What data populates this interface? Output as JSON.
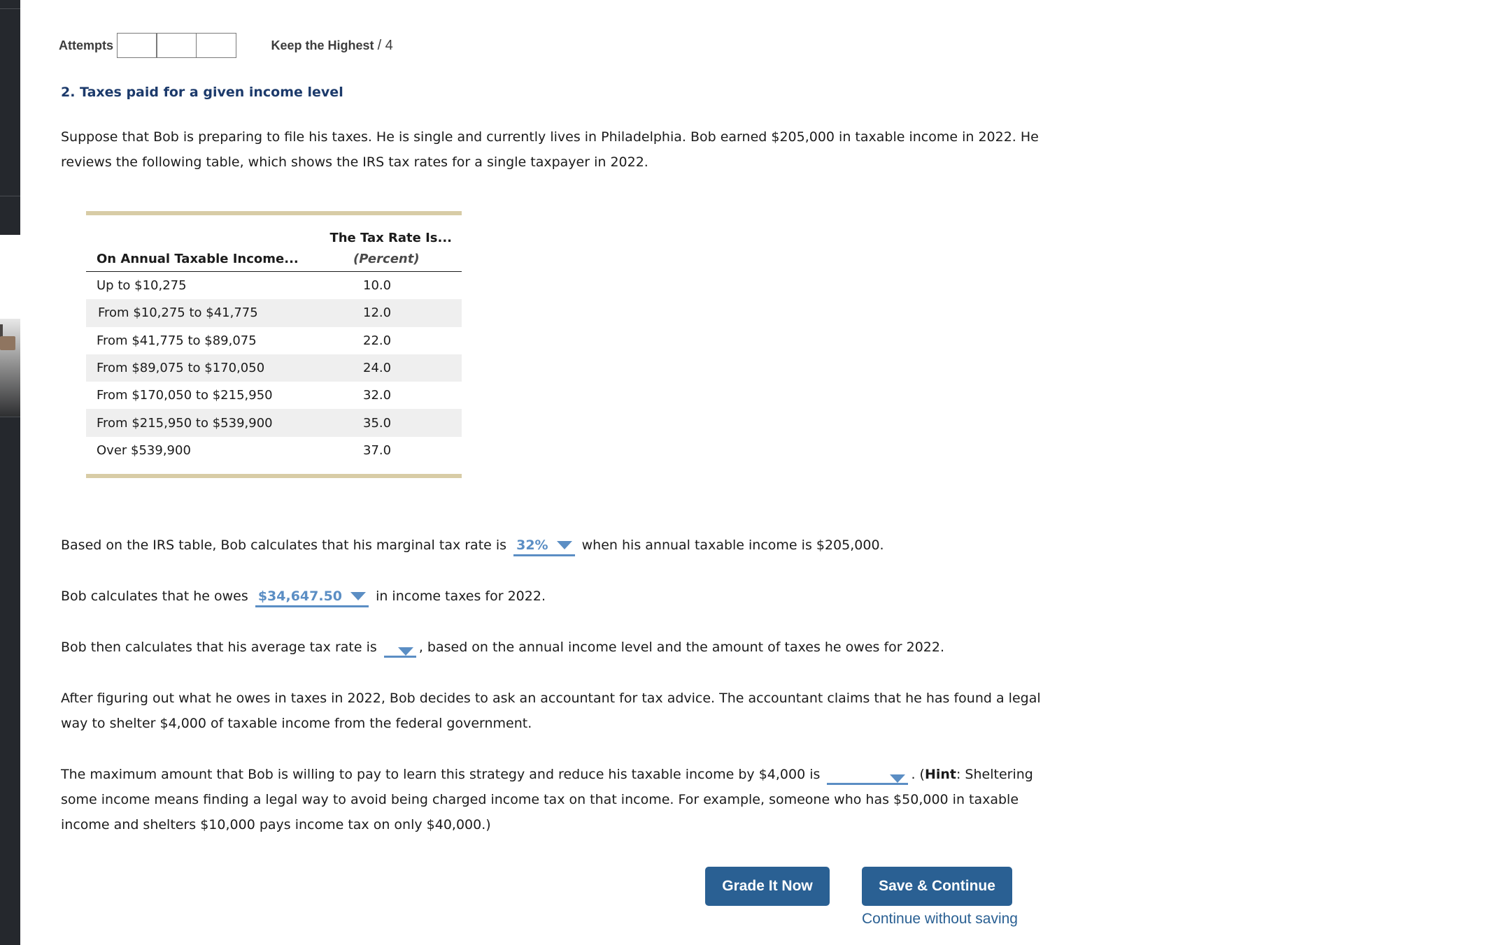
{
  "header": {
    "attempts_label": "Attempts",
    "attempt_boxes": [
      "",
      "",
      ""
    ],
    "keep_label": "Keep the Highest",
    "keep_denominator": "/ 4"
  },
  "question": {
    "title": "2. Taxes paid for a given income level",
    "intro": "Suppose that Bob is preparing to file his taxes. He is single and currently lives in Philadelphia. Bob earned $205,000 in taxable income in 2022. He reviews the following table, which shows the IRS tax rates for a single taxpayer in 2022."
  },
  "tax_table": {
    "col1_header": "On Annual Taxable Income...",
    "col2_header_line1": "The Tax Rate Is...",
    "col2_header_line2": "(Percent)",
    "rows": [
      {
        "income": "Up to $10,275",
        "rate": "10.0"
      },
      {
        "income": "From $10,275 to $41,775",
        "rate": "12.0"
      },
      {
        "income": "From $41,775 to $89,075",
        "rate": "22.0"
      },
      {
        "income": "From $89,075 to $170,050",
        "rate": "24.0"
      },
      {
        "income": "From $170,050 to $215,950",
        "rate": "32.0"
      },
      {
        "income": "From $215,950 to $539,900",
        "rate": "35.0"
      },
      {
        "income": "Over $539,900",
        "rate": "37.0"
      }
    ]
  },
  "sentences": {
    "marginal": {
      "before": "Based on the IRS table, Bob calculates that his marginal tax rate is",
      "selected": "32%",
      "after": "when his annual taxable income is $205,000."
    },
    "owes": {
      "before": "Bob calculates that he owes",
      "selected": "$34,647.50",
      "after": "in income taxes for 2022."
    },
    "average": {
      "before": "Bob then calculates that his average tax rate is",
      "selected": "",
      "after": ", based on the annual income level and the amount of taxes he owes for 2022."
    },
    "accountant": "After figuring out what he owes in taxes in 2022, Bob decides to ask an accountant for tax advice. The accountant claims that he has found a legal way to shelter $4,000 of taxable income from the federal government.",
    "max_amount": {
      "before": "The maximum amount that Bob is willing to pay to learn this strategy and reduce his taxable income by $4,000 is",
      "selected": "",
      "after_prefix": ". (",
      "hint_label": "Hint",
      "after": ": Sheltering some income means finding a legal way to avoid being charged income tax on that income. For example, someone who has $50,000 in taxable income and shelters $10,000 pays income tax on only $40,000.)"
    }
  },
  "actions": {
    "grade_label": "Grade It Now",
    "save_label": "Save & Continue",
    "continue_label": "Continue without saving"
  },
  "colors": {
    "title": "#1c3a6b",
    "dropdown_accent": "#5b8ec4",
    "button_bg": "#2a6093",
    "table_rule": "#d8cca6",
    "sidebar": "#25282d"
  }
}
